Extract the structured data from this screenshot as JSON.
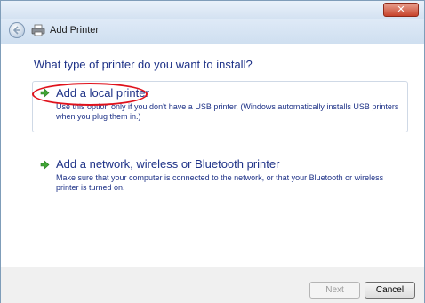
{
  "window": {
    "close_glyph": "✕"
  },
  "navbar": {
    "title": "Add Printer",
    "back_icon": "back-arrow-icon",
    "printer_icon": "printer-icon"
  },
  "main": {
    "heading": "What type of printer do you want to install?",
    "options": [
      {
        "title": "Add a local printer",
        "description": "Use this option only if you don't have a USB printer. (Windows automatically installs USB printers when you plug them in.)",
        "icon": "green-arrow-icon"
      },
      {
        "title": "Add a network, wireless or Bluetooth printer",
        "description": "Make sure that your computer is connected to the network, or that your Bluetooth or wireless printer is turned on.",
        "icon": "green-arrow-icon"
      }
    ]
  },
  "footer": {
    "next_label": "Next",
    "cancel_label": "Cancel"
  },
  "colors": {
    "link_blue": "#1e3287",
    "highlight_red": "#e0121c",
    "close_red": "#c7432b"
  }
}
